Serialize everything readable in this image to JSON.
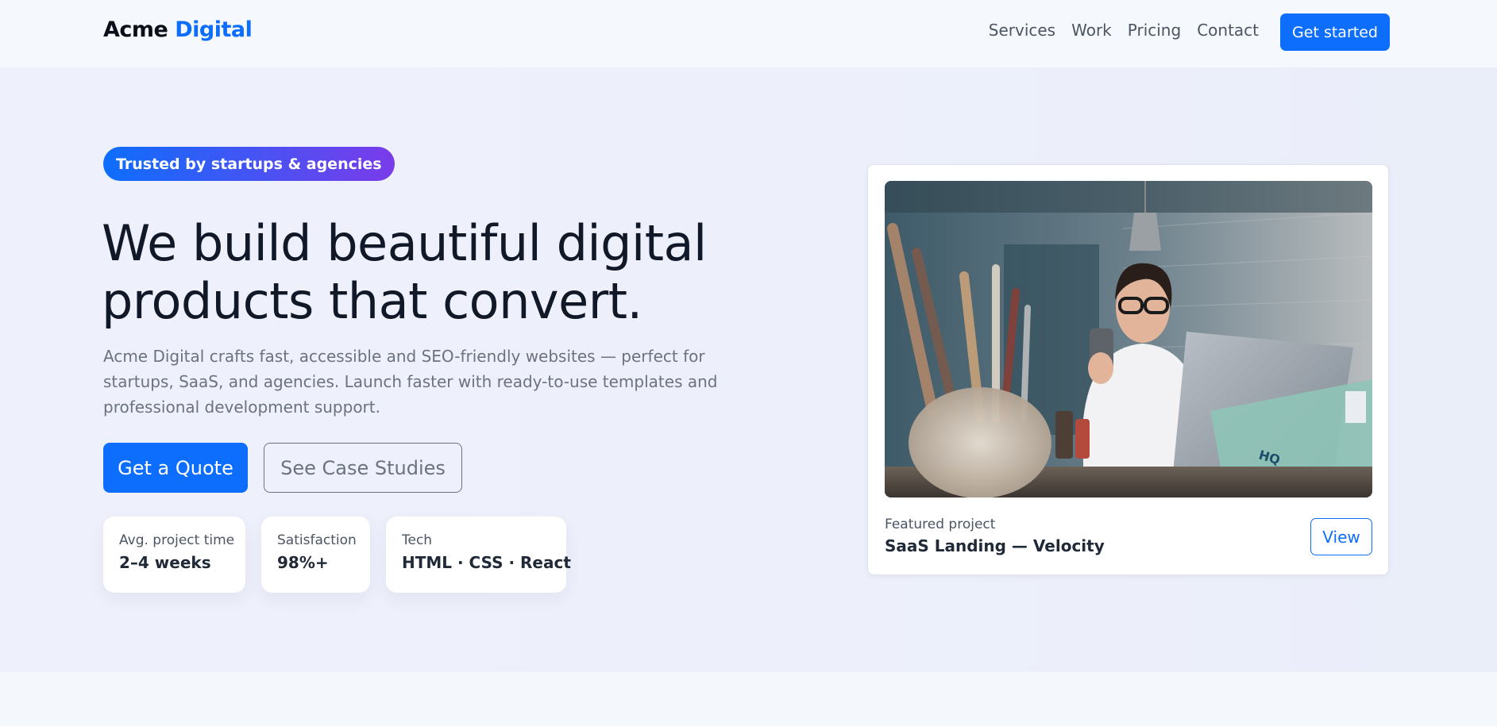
{
  "brand": {
    "name_part1": "Acme",
    "name_part2": "Digital"
  },
  "nav": {
    "links": [
      "Services",
      "Work",
      "Pricing",
      "Contact"
    ],
    "cta_label": "Get started"
  },
  "hero": {
    "badge": "Trusted by startups & agencies",
    "title_line1": "We build beautiful digital",
    "title_line2": "products that convert.",
    "sub_line1": "Acme Digital crafts fast, accessible and SEO-friendly websites — perfect for",
    "sub_line2": "startups, SaaS, and agencies. Launch faster with ready-to-use templates and",
    "sub_line3": "professional development support.",
    "primary_button": "Get a Quote",
    "secondary_button": "See Case Studies",
    "stats": [
      {
        "label": "Avg. project time",
        "value": "2–4 weeks"
      },
      {
        "label": "Satisfaction",
        "value": "98%+"
      },
      {
        "label": "Tech",
        "value": "HTML · CSS · React"
      }
    ]
  },
  "featured": {
    "label": "Featured project",
    "title": "SaaS Landing — Velocity",
    "view_button": "View"
  },
  "colors": {
    "primary": "#0d6efd",
    "badge_gradient_end": "#7a3bea",
    "text_dark": "#111827",
    "text_muted": "#6b7280"
  }
}
